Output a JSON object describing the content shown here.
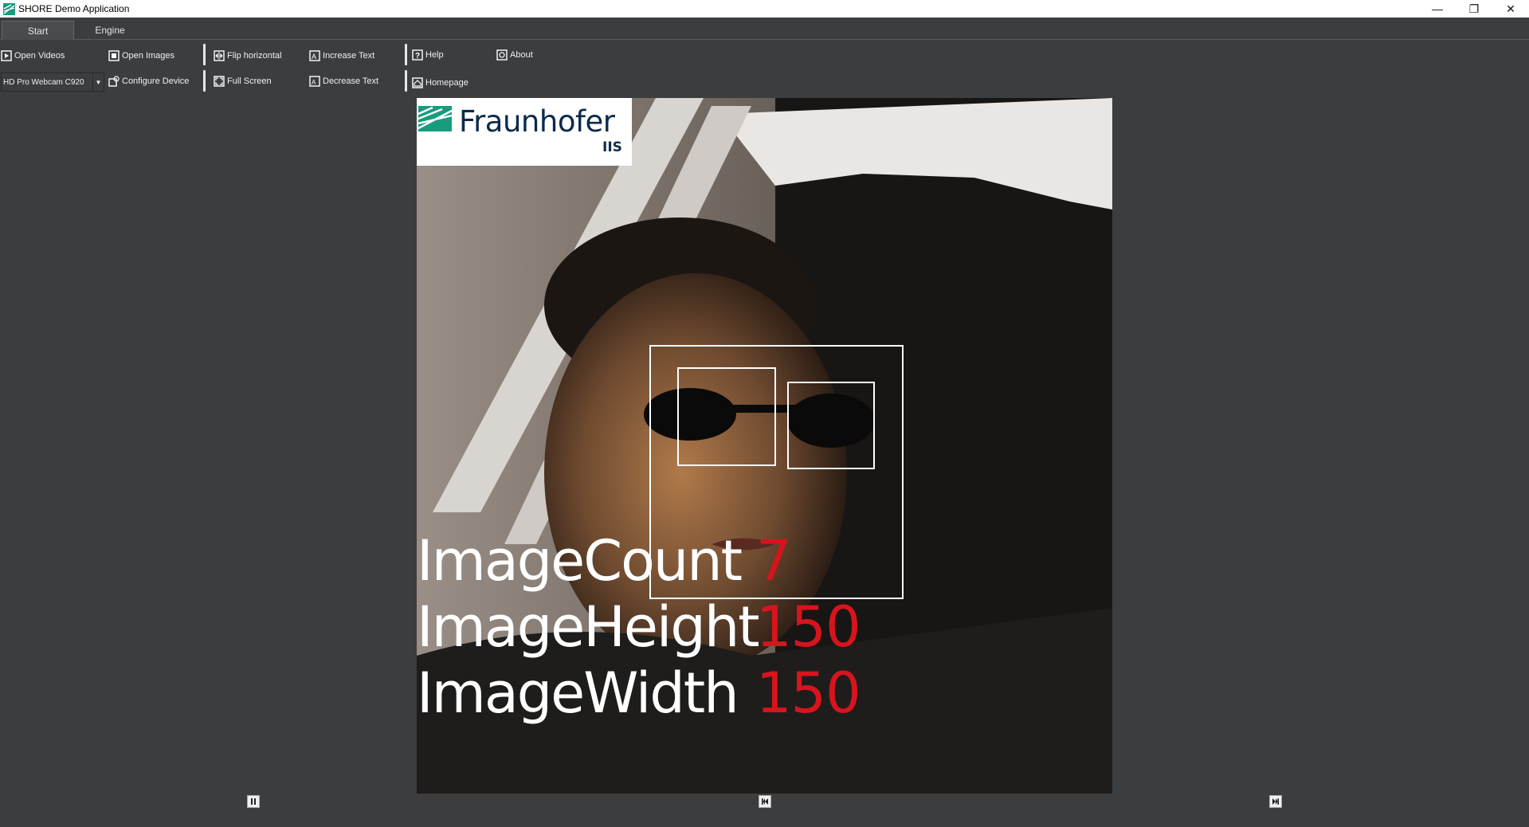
{
  "window": {
    "title": "SHORE Demo Application",
    "minimize_glyph": "—",
    "restore_glyph": "❐",
    "close_glyph": "✕"
  },
  "tabs": [
    {
      "label": "Start",
      "active": true
    },
    {
      "label": "Engine",
      "active": false
    }
  ],
  "ribbon": {
    "open_videos": "Open Videos",
    "open_images": "Open Images",
    "flip_horizontal": "Flip horizontal",
    "increase_text": "Increase Text",
    "help": "Help",
    "about": "About",
    "device_select": "HD Pro Webcam C920",
    "configure_device": "Configure Device",
    "full_screen": "Full Screen",
    "decrease_text": "Decrease Text",
    "homepage": "Homepage"
  },
  "viewer": {
    "logo_name": "Fraunhofer",
    "logo_sub": "IIS",
    "stats": [
      {
        "label": "ImageCount",
        "value": "7"
      },
      {
        "label": "ImageHeight",
        "value": "150"
      },
      {
        "label": "ImageWidth",
        "value": "150"
      }
    ]
  },
  "playback": {
    "pause": "pause",
    "previous": "previous",
    "next": "next"
  },
  "colors": {
    "background": "#3c3d3f",
    "stat_value": "#d7141e",
    "brand_green": "#179c7d"
  }
}
